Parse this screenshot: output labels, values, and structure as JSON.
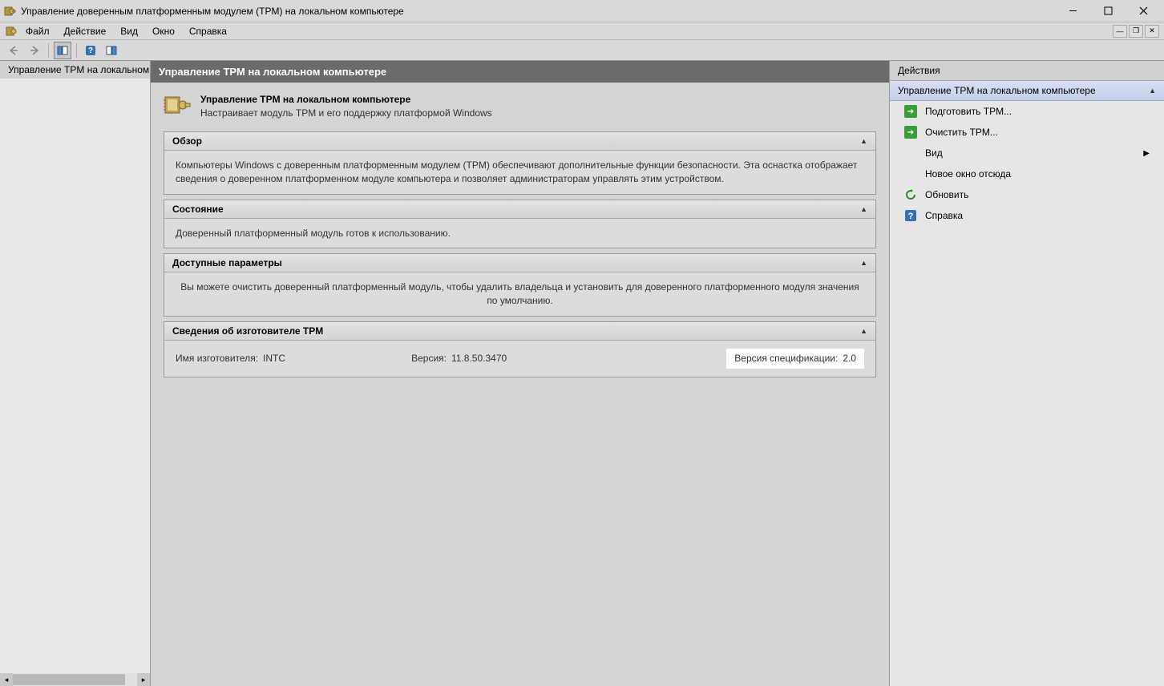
{
  "window": {
    "title": "Управление доверенным платформенным модулем (TPM) на локальном компьютере"
  },
  "menubar": {
    "items": [
      "Файл",
      "Действие",
      "Вид",
      "Окно",
      "Справка"
    ]
  },
  "tree": {
    "item": "Управление TPM на локальном компьютере"
  },
  "center": {
    "header": "Управление TPM на локальном компьютере",
    "intro_title": "Управление TPM на локальном компьютере",
    "intro_desc": "Настраивает модуль TPM и его поддержку платформой Windows",
    "overview": {
      "title": "Обзор",
      "body": "Компьютеры Windows с доверенным платформенным модулем (TPM) обеспечивают дополнительные функции безопасности. Эта оснастка отображает сведения о доверенном платформенном модуле компьютера и позволяет администраторам управлять этим устройством."
    },
    "status": {
      "title": "Состояние",
      "body": "Доверенный платформенный модуль готов к использованию."
    },
    "params": {
      "title": "Доступные параметры",
      "body": "Вы можете очистить доверенный платформенный модуль, чтобы удалить владельца и установить для доверенного платформенного модуля значения по умолчанию."
    },
    "mfr": {
      "title": "Сведения об изготовителе TPM",
      "name_label": "Имя изготовителя:",
      "name_value": "INTC",
      "ver_label": "Версия:",
      "ver_value": "11.8.50.3470",
      "spec_label": "Версия спецификации:",
      "spec_value": "2.0"
    }
  },
  "actions": {
    "header": "Действия",
    "subheader": "Управление TPM на локальном компьютере",
    "items": {
      "prepare": "Подготовить TPM...",
      "clear": "Очистить TPM...",
      "view": "Вид",
      "new_window": "Новое окно отсюда",
      "refresh": "Обновить",
      "help": "Справка"
    }
  }
}
